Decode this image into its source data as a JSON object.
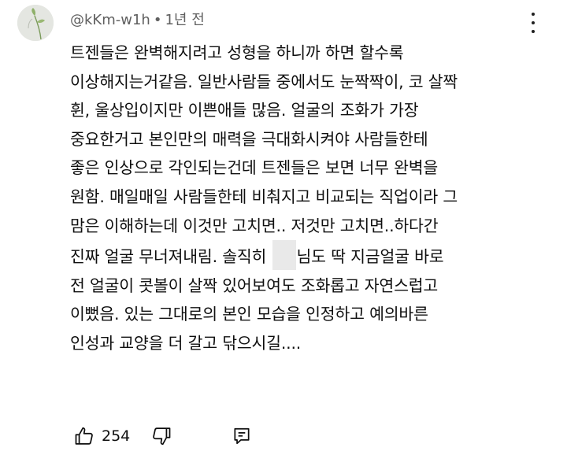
{
  "comment": {
    "author": "@kKm-w1h",
    "separator": "•",
    "timestamp": "1년 전",
    "avatar_icon": "plant-sprout-avatar",
    "text_lines": [
      "트젠들은 완벽해지려고 성형을 하니까 하면 할수록",
      "이상해지는거같음. 일반사람들 중에서도 눈짝짝이, 코 살짝",
      "휜, 울상입이지만 이쁜애들 많음. 얼굴의 조화가 가장",
      "중요한거고 본인만의 매력을 극대화시켜야 사람들한테",
      "좋은 인상으로 각인되는건데 트젠들은 보면 너무 완벽을",
      "원함. 매일매일 사람들한테 비춰지고 비교되는 직업이라 그",
      "맘은 이해하는데 이것만 고치면.. 저것만 고치면..하다간"
    ],
    "line8_before": "진짜 얼굴 무너져내림. 솔직히 ",
    "line8_after": "님도 딱 지금얼굴 바로",
    "text_lines_end": [
      "전 얼굴이 콧볼이 살짝 있어보여도 조화롭고 자연스럽고",
      "이뻤음. 있는 그대로의 본인 모습을 인정하고 예의바른",
      "인성과 교양을 더 갈고 닦으시길...."
    ],
    "like_count": "254",
    "icons": {
      "like": "thumbs-up-icon",
      "dislike": "thumbs-down-icon",
      "reply": "reply-icon",
      "more": "more-vertical-icon"
    }
  }
}
